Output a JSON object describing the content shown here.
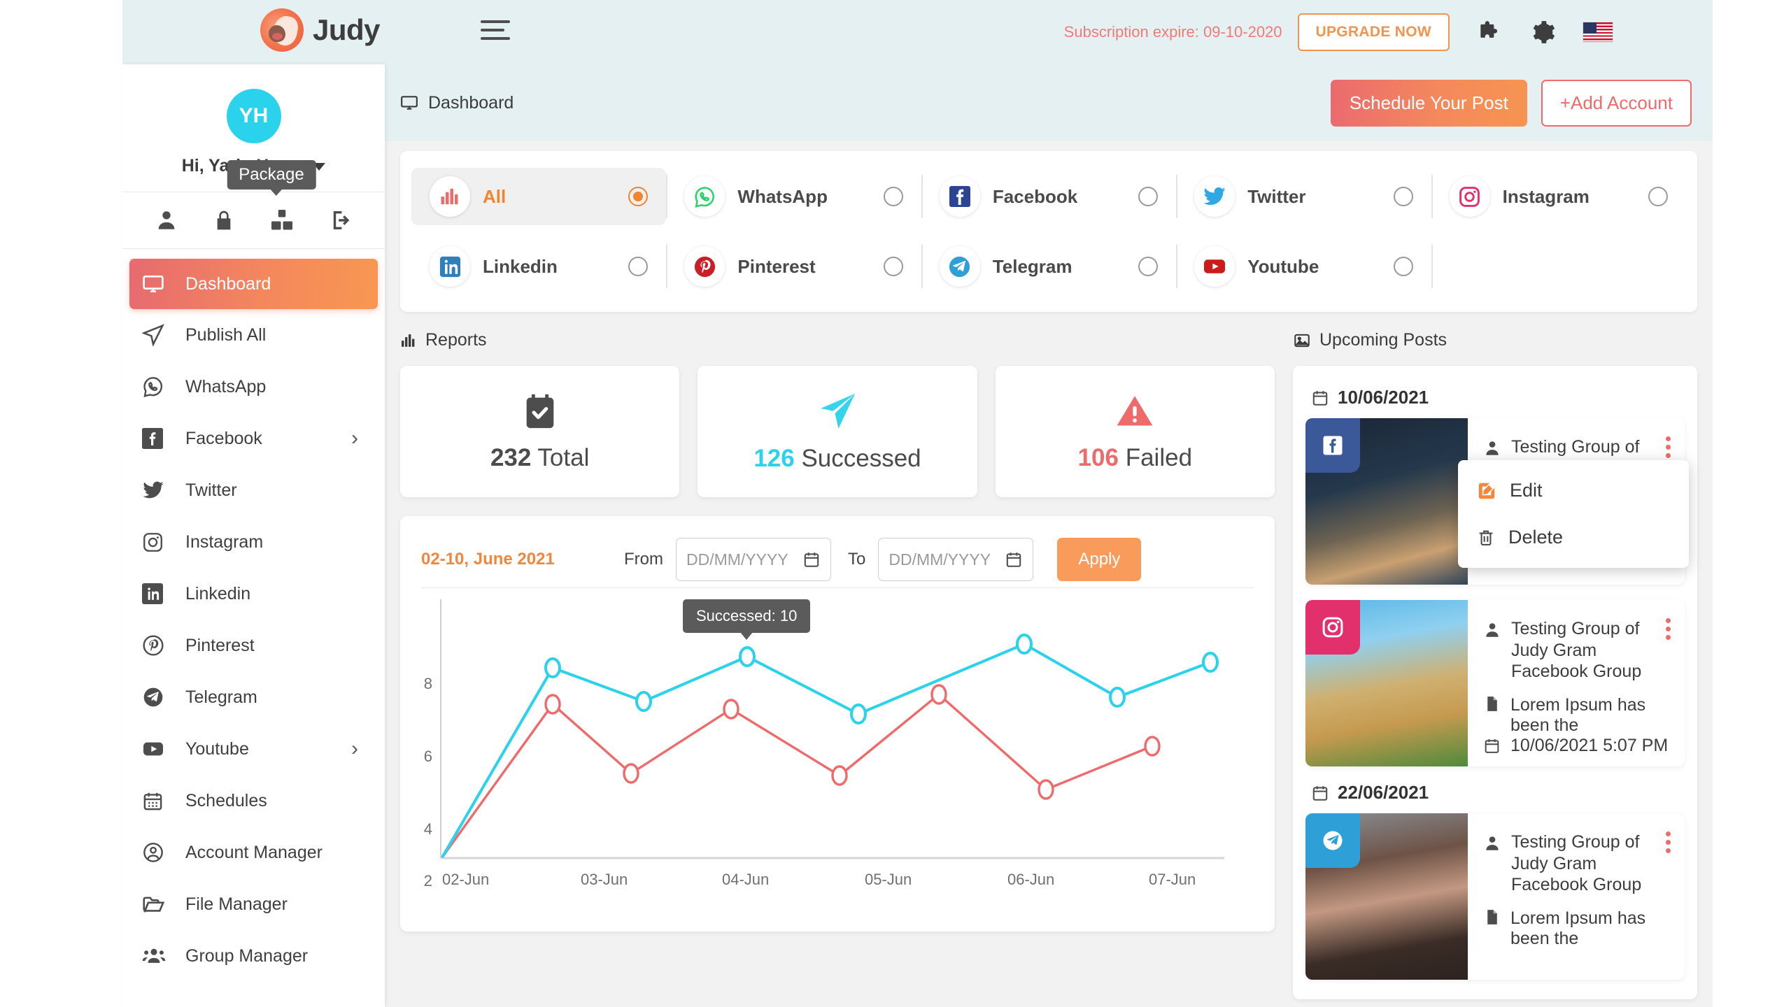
{
  "header": {
    "brand_name": "Judy",
    "subscription_text": "Subscription expire: 09-10-2020",
    "upgrade_label": "UPGRADE NOW"
  },
  "sidebar": {
    "avatar_initials": "YH",
    "greeting": "Hi, Yarin Hazon",
    "tooltip": "Package",
    "quick_actions": [
      "profile-icon",
      "lock-icon",
      "package-icon",
      "logout-icon"
    ],
    "items": [
      {
        "label": "Dashboard",
        "icon": "monitor-icon",
        "active": true,
        "chevron": false
      },
      {
        "label": "Publish All",
        "icon": "paper-plane-icon",
        "active": false,
        "chevron": false
      },
      {
        "label": "WhatsApp",
        "icon": "whatsapp-icon",
        "active": false,
        "chevron": false
      },
      {
        "label": "Facebook",
        "icon": "facebook-icon",
        "active": false,
        "chevron": true
      },
      {
        "label": "Twitter",
        "icon": "twitter-icon",
        "active": false,
        "chevron": false
      },
      {
        "label": "Instagram",
        "icon": "instagram-icon",
        "active": false,
        "chevron": false
      },
      {
        "label": "Linkedin",
        "icon": "linkedin-icon",
        "active": false,
        "chevron": false
      },
      {
        "label": "Pinterest",
        "icon": "pinterest-icon",
        "active": false,
        "chevron": false
      },
      {
        "label": "Telegram",
        "icon": "telegram-icon",
        "active": false,
        "chevron": false
      },
      {
        "label": "Youtube",
        "icon": "youtube-icon",
        "active": false,
        "chevron": true
      },
      {
        "label": "Schedules",
        "icon": "calendar-icon",
        "active": false,
        "chevron": false
      },
      {
        "label": "Account Manager",
        "icon": "account-circle-icon",
        "active": false,
        "chevron": false
      },
      {
        "label": "File Manager",
        "icon": "folder-icon",
        "active": false,
        "chevron": false
      },
      {
        "label": "Group Manager",
        "icon": "group-icon",
        "active": false,
        "chevron": false
      }
    ]
  },
  "main": {
    "page_title": "Dashboard",
    "schedule_button": "Schedule Your Post",
    "add_account_button": "+Add Account",
    "networks": [
      {
        "label": "All",
        "selected": true,
        "icon": "bar-chart-icon"
      },
      {
        "label": "WhatsApp",
        "selected": false,
        "icon": "whatsapp-icon"
      },
      {
        "label": "Facebook",
        "selected": false,
        "icon": "facebook-icon"
      },
      {
        "label": "Twitter",
        "selected": false,
        "icon": "twitter-icon"
      },
      {
        "label": "Instagram",
        "selected": false,
        "icon": "instagram-icon"
      },
      {
        "label": "Linkedin",
        "selected": false,
        "icon": "linkedin-icon"
      },
      {
        "label": "Pinterest",
        "selected": false,
        "icon": "pinterest-icon"
      },
      {
        "label": "Telegram",
        "selected": false,
        "icon": "telegram-icon"
      },
      {
        "label": "Youtube",
        "selected": false,
        "icon": "youtube-icon"
      }
    ],
    "reports": {
      "title": "Reports",
      "stats": [
        {
          "value": "232",
          "label": " Total",
          "color": "#4b4b4b",
          "icon": "calendar-check-icon"
        },
        {
          "value": "126",
          "label": " Successed",
          "color": "#2ad2ec",
          "icon": "paper-plane-icon"
        },
        {
          "value": "106",
          "label": " Failed",
          "color": "#ef6b6b",
          "icon": "warning-triangle-icon"
        }
      ]
    },
    "date_filter": {
      "range_text": "02-10, June 2021",
      "from_label": "From",
      "to_label": "To",
      "from_placeholder": "DD/MM/YYYY",
      "to_placeholder": "DD/MM/YYYY",
      "from_value": "",
      "to_value": "",
      "apply_label": "Apply"
    }
  },
  "chart_data": {
    "type": "line",
    "title": "",
    "xlabel": "",
    "ylabel": "",
    "ylim": [
      2,
      11
    ],
    "yticks": [
      2,
      4,
      6,
      8
    ],
    "xticks": [
      "02-Jun",
      "03-Jun",
      "04-Jun",
      "05-Jun",
      "06-Jun",
      "07-Jun"
    ],
    "grid": false,
    "legend": "none",
    "tooltip": "Successed: 10",
    "x": [
      0,
      0.5,
      1,
      1.5,
      2,
      2.5,
      3,
      3.5,
      4,
      4.5,
      5
    ],
    "series": [
      {
        "name": "Successed",
        "color": "#2ad2ec",
        "values": [
          2.0,
          8.7,
          7.7,
          9.0,
          7.2,
          9.4,
          7.75,
          8.85,
          null,
          null,
          null
        ]
      },
      {
        "name": "Failed",
        "color": "#ef6b6b",
        "values": [
          2.0,
          7.4,
          5.4,
          7.3,
          5.35,
          7.55,
          5.1,
          6.15,
          null,
          null,
          null
        ]
      }
    ]
  },
  "upcoming": {
    "title": "Upcoming Posts",
    "groups": [
      {
        "date": "10/06/2021",
        "posts": [
          {
            "network": "facebook-icon",
            "name": "Testing Group of Judy Gram",
            "subname": "Facebook Group",
            "text": "",
            "time": "10/06/2021 5:07 PM",
            "thumb": "sparkler",
            "menu_open": true
          },
          {
            "network": "instagram-icon",
            "name": "Testing Group of Judy Gram",
            "subname": "Facebook Group",
            "text": "Lorem Ipsum has been the",
            "time": "10/06/2021 5:07 PM",
            "thumb": "temple",
            "menu_open": false
          }
        ]
      },
      {
        "date": "22/06/2021",
        "posts": [
          {
            "network": "telegram-icon",
            "name": "Testing Group of Judy Gram",
            "subname": "Facebook Group",
            "text": "Lorem Ipsum has been the",
            "time": "",
            "thumb": "woman",
            "menu_open": false
          }
        ]
      }
    ],
    "context_menu": {
      "edit": "Edit",
      "delete": "Delete"
    }
  },
  "colors": {
    "accent_orange": "#f0842f",
    "accent_red": "#ef6b6b",
    "accent_cyan": "#2ad2ec",
    "header_bg": "#e4f0f1",
    "page_bg": "#f2f2f2"
  }
}
